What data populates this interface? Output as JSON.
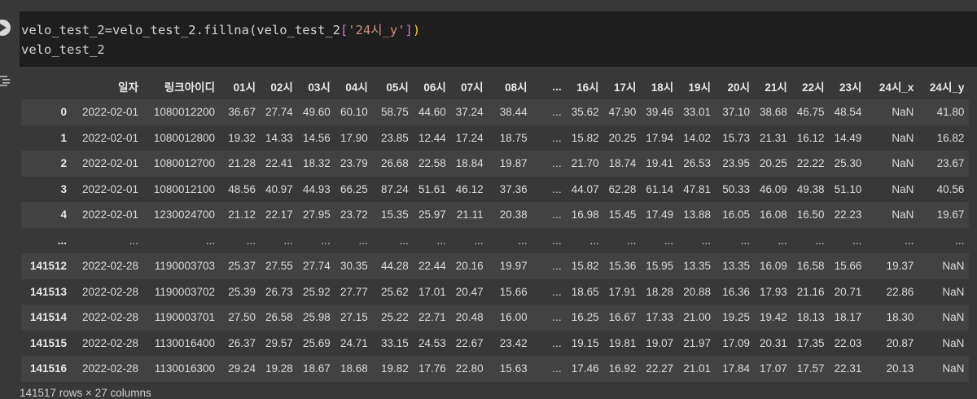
{
  "code": {
    "line1_left": "velo_test_2=velo_test_2.fillna(velo_test_2",
    "line1_bracket_open": "[",
    "line1_string": "'24시_y'",
    "line1_bracket_close": "]",
    "line1_paren_close": ")",
    "line2": "velo_test_2"
  },
  "table": {
    "columns": [
      "",
      "일자",
      "링크아이디",
      "01시",
      "02시",
      "03시",
      "04시",
      "05시",
      "06시",
      "07시",
      "08시",
      "...",
      "16시",
      "17시",
      "18시",
      "19시",
      "20시",
      "21시",
      "22시",
      "23시",
      "24시_x",
      "24시_y"
    ],
    "rows": [
      [
        "0",
        "2022-02-01",
        "1080012200",
        "36.67",
        "27.74",
        "49.60",
        "60.10",
        "58.75",
        "44.60",
        "37.24",
        "38.44",
        "...",
        "35.62",
        "47.90",
        "39.46",
        "33.01",
        "37.10",
        "38.68",
        "46.75",
        "48.54",
        "NaN",
        "41.80"
      ],
      [
        "1",
        "2022-02-01",
        "1080012800",
        "19.32",
        "14.33",
        "14.56",
        "17.90",
        "23.85",
        "12.44",
        "17.24",
        "18.75",
        "...",
        "15.82",
        "20.25",
        "17.94",
        "14.02",
        "15.73",
        "21.31",
        "16.12",
        "14.49",
        "NaN",
        "16.82"
      ],
      [
        "2",
        "2022-02-01",
        "1080012700",
        "21.28",
        "22.41",
        "18.32",
        "23.79",
        "26.68",
        "22.58",
        "18.84",
        "19.87",
        "...",
        "21.70",
        "18.74",
        "19.41",
        "26.53",
        "23.95",
        "20.25",
        "22.22",
        "25.30",
        "NaN",
        "23.67"
      ],
      [
        "3",
        "2022-02-01",
        "1080012100",
        "48.56",
        "40.97",
        "44.93",
        "66.25",
        "87.24",
        "51.61",
        "46.12",
        "37.36",
        "...",
        "44.07",
        "62.28",
        "61.14",
        "47.81",
        "50.33",
        "46.09",
        "49.38",
        "51.10",
        "NaN",
        "40.56"
      ],
      [
        "4",
        "2022-02-01",
        "1230024700",
        "21.12",
        "22.17",
        "27.95",
        "23.72",
        "15.35",
        "25.97",
        "21.11",
        "20.38",
        "...",
        "16.98",
        "15.45",
        "17.49",
        "13.88",
        "16.05",
        "16.08",
        "16.50",
        "22.23",
        "NaN",
        "19.67"
      ],
      [
        "...",
        "...",
        "...",
        "...",
        "...",
        "...",
        "...",
        "...",
        "...",
        "...",
        "...",
        "...",
        "...",
        "...",
        "...",
        "...",
        "...",
        "...",
        "...",
        "...",
        "...",
        "..."
      ],
      [
        "141512",
        "2022-02-28",
        "1190003703",
        "25.37",
        "27.55",
        "27.74",
        "30.35",
        "44.28",
        "22.44",
        "20.16",
        "19.97",
        "...",
        "15.82",
        "15.36",
        "15.95",
        "13.35",
        "13.35",
        "16.09",
        "16.58",
        "15.66",
        "19.37",
        "NaN"
      ],
      [
        "141513",
        "2022-02-28",
        "1190003702",
        "25.39",
        "26.73",
        "25.92",
        "27.77",
        "25.62",
        "17.01",
        "20.47",
        "15.66",
        "...",
        "18.65",
        "17.91",
        "18.28",
        "20.88",
        "16.36",
        "17.93",
        "21.16",
        "20.71",
        "22.86",
        "NaN"
      ],
      [
        "141514",
        "2022-02-28",
        "1190003701",
        "27.50",
        "26.58",
        "25.98",
        "27.15",
        "25.22",
        "22.71",
        "20.48",
        "16.00",
        "...",
        "16.25",
        "16.67",
        "17.33",
        "21.00",
        "19.25",
        "19.42",
        "18.13",
        "18.17",
        "18.30",
        "NaN"
      ],
      [
        "141515",
        "2022-02-28",
        "1130016400",
        "26.37",
        "29.57",
        "25.69",
        "24.71",
        "33.15",
        "24.53",
        "22.67",
        "23.42",
        "...",
        "19.15",
        "19.81",
        "19.07",
        "21.97",
        "17.09",
        "20.31",
        "17.35",
        "22.03",
        "20.87",
        "NaN"
      ],
      [
        "141516",
        "2022-02-28",
        "1130016300",
        "29.24",
        "19.28",
        "18.67",
        "18.68",
        "19.82",
        "17.76",
        "22.80",
        "15.63",
        "...",
        "17.46",
        "16.92",
        "22.27",
        "21.01",
        "17.84",
        "17.07",
        "17.57",
        "22.31",
        "20.13",
        "NaN"
      ]
    ],
    "footer": "141517 rows × 27 columns"
  },
  "icons": {
    "run": "play-circle-icon",
    "output": "output-settings-icon"
  }
}
